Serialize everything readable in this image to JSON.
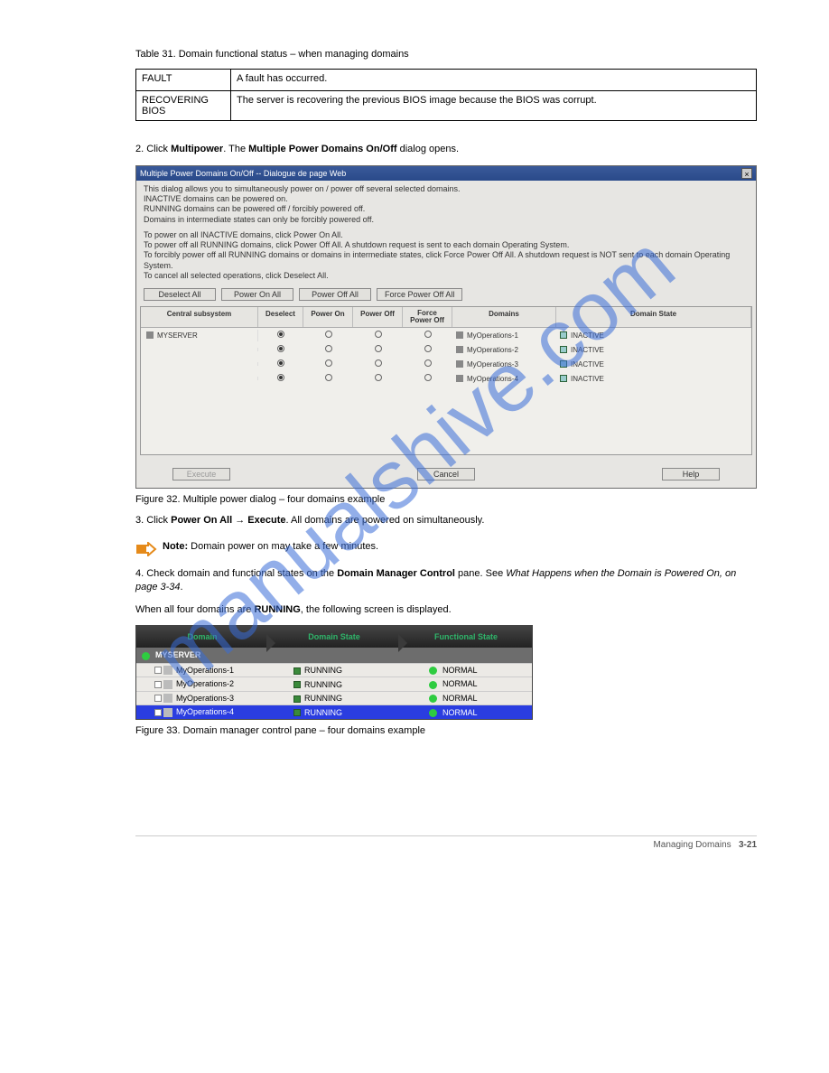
{
  "watermark": "manualshive.com",
  "table31": {
    "caption": "Table 31. Domain functional status – when managing domains",
    "rows": [
      {
        "a": "FAULT",
        "b": "A fault has occurred."
      },
      {
        "a": "RECOVERING BIOS",
        "b": "The server is recovering the previous BIOS image because the BIOS was corrupt."
      }
    ]
  },
  "step2": "2. Click Multipower. The Multiple Power Domains On/Off dialog opens.",
  "dialog": {
    "title": "Multiple Power Domains On/Off -- Dialogue de page Web",
    "intro": [
      "This dialog allows you to simultaneously power on / power off several selected domains.",
      "INACTIVE domains can be powered on.",
      "RUNNING domains can be powered off / forcibly powered off.",
      "Domains in intermediate states can only be forcibly powered off."
    ],
    "intro2": [
      "To power on all INACTIVE domains, click Power On All.",
      "To power off all RUNNING domains, click Power Off All. A shutdown request is sent to each domain Operating System.",
      "To forcibly power off all RUNNING domains or domains in intermediate states, click Force Power Off All. A shutdown request is NOT sent to each domain Operating System.",
      "To cancel all selected operations, click Deselect All."
    ],
    "topButtons": [
      "Deselect All",
      "Power On All",
      "Power Off All",
      "Force Power Off All"
    ],
    "headers": {
      "csub": "Central subsystem",
      "desel": "Deselect",
      "pon": "Power On",
      "poff": "Power Off",
      "fpoff": "Force\nPower Off",
      "dom": "Domains",
      "dst": "Domain State"
    },
    "server": "MYSERVER",
    "rows": [
      {
        "domain": "MyOperations-1",
        "state": "INACTIVE"
      },
      {
        "domain": "MyOperations-2",
        "state": "INACTIVE"
      },
      {
        "domain": "MyOperations-3",
        "state": "INACTIVE"
      },
      {
        "domain": "MyOperations-4",
        "state": "INACTIVE"
      }
    ],
    "bottom": {
      "execute": "Execute",
      "cancel": "Cancel",
      "help": "Help"
    }
  },
  "fig32": "Figure 32. Multiple power dialog – four domains example",
  "step3": "3. Click Power On All → Execute. All domains are powered on simultaneously.",
  "noteA": {
    "label": "Note:",
    "text": "Domain power on may take a few minutes."
  },
  "step4": {
    "text": "4. Check domain and functional states on the Domain Manager Control pane.",
    "link": "What Happens when the Domain is Powered On, on page 3-34"
  },
  "step4b": "When all four domains are RUNNING, the following screen is displayed.",
  "panel": {
    "headers": [
      "Domain",
      "Domain State",
      "Functional State"
    ],
    "server": "MYSERVER",
    "rows": [
      {
        "name": "MyOperations-1",
        "ds": "RUNNING",
        "fs": "NORMAL",
        "sel": false
      },
      {
        "name": "MyOperations-2",
        "ds": "RUNNING",
        "fs": "NORMAL",
        "sel": false
      },
      {
        "name": "MyOperations-3",
        "ds": "RUNNING",
        "fs": "NORMAL",
        "sel": false
      },
      {
        "name": "MyOperations-4",
        "ds": "RUNNING",
        "fs": "NORMAL",
        "sel": true
      }
    ]
  },
  "fig33": "Figure 33. Domain manager control pane – four domains example",
  "footer": {
    "label": "Managing Domains",
    "page": "3-21"
  }
}
